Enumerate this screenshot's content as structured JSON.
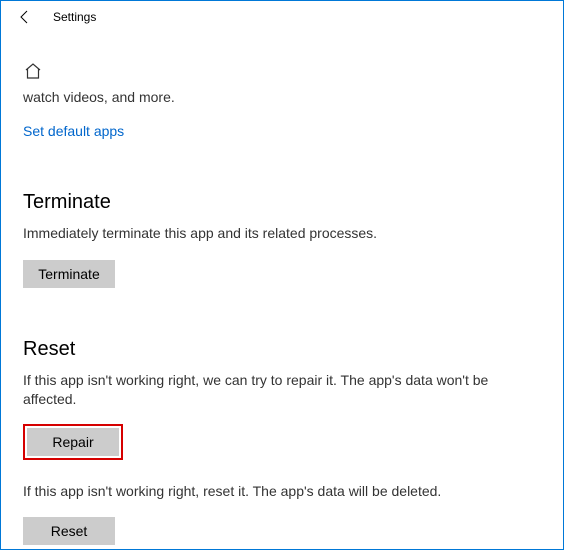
{
  "titlebar": {
    "title": "Settings"
  },
  "clipped_line": "watch videos, and more.",
  "link_default_apps": "Set default apps",
  "terminate": {
    "heading": "Terminate",
    "desc": "Immediately terminate this app and its related processes.",
    "button": "Terminate"
  },
  "reset": {
    "heading": "Reset",
    "repair_desc": "If this app isn't working right, we can try to repair it. The app's data won't be affected.",
    "repair_button": "Repair",
    "reset_desc": "If this app isn't working right, reset it. The app's data will be deleted.",
    "reset_button": "Reset"
  }
}
